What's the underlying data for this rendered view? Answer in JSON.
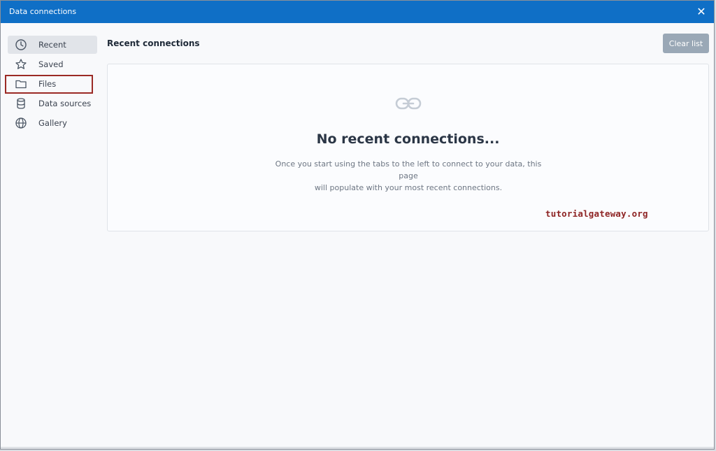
{
  "window": {
    "title": "Data connections",
    "close_icon": "close-icon"
  },
  "sidebar": {
    "items": [
      {
        "label": "Recent",
        "icon": "clock-icon",
        "active": true
      },
      {
        "label": "Saved",
        "icon": "star-icon",
        "active": false
      },
      {
        "label": "Files",
        "icon": "folder-icon",
        "active": false
      },
      {
        "label": "Data sources",
        "icon": "database-icon",
        "active": false
      },
      {
        "label": "Gallery",
        "icon": "globe-icon",
        "active": false
      }
    ]
  },
  "main": {
    "section_title": "Recent connections",
    "clear_label": "Clear list",
    "empty_heading": "No recent connections...",
    "empty_line1": "Once you start using the tabs to the left to connect to your data, this page",
    "empty_line2": "will populate with your most recent connections.",
    "empty_icon": "link-icon"
  },
  "watermark": "tutorialgateway.org",
  "colors": {
    "titlebar": "#0f6fc6",
    "highlight_border": "#9b2a25",
    "clear_button": "#9aa8b6",
    "watermark": "#8e2424"
  }
}
